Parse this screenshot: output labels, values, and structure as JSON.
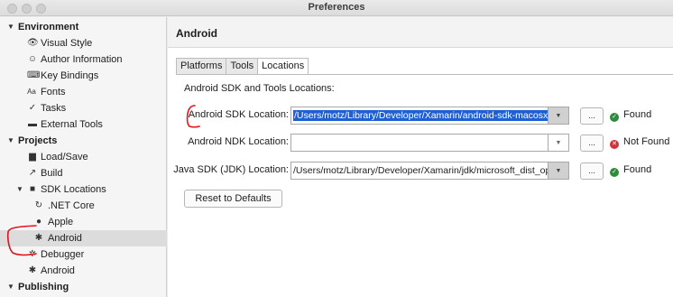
{
  "window": {
    "title": "Preferences"
  },
  "sidebar": {
    "items": [
      {
        "label": "Environment",
        "kind": "category",
        "icon": "disclosure-open"
      },
      {
        "label": "Visual Style",
        "kind": "item",
        "icon": "eye-icon"
      },
      {
        "label": "Author Information",
        "kind": "item",
        "icon": "smiley-icon"
      },
      {
        "label": "Key Bindings",
        "kind": "item",
        "icon": "keyboard-icon"
      },
      {
        "label": "Fonts",
        "kind": "item",
        "icon": "fonts-icon",
        "icon_glyph": "Aa"
      },
      {
        "label": "Tasks",
        "kind": "item",
        "icon": "checkmark-icon"
      },
      {
        "label": "External Tools",
        "kind": "item",
        "icon": "toolbox-icon"
      },
      {
        "label": "Projects",
        "kind": "category",
        "icon": "disclosure-open"
      },
      {
        "label": "Load/Save",
        "kind": "item",
        "icon": "drive-icon"
      },
      {
        "label": "Build",
        "kind": "item",
        "icon": "hammer-icon"
      },
      {
        "label": "SDK Locations",
        "kind": "folder",
        "icon": "folder-icon"
      },
      {
        "label": ".NET Core",
        "kind": "subitem",
        "icon": "dotnet-icon"
      },
      {
        "label": "Apple",
        "kind": "subitem",
        "icon": "apple-icon"
      },
      {
        "label": "Android",
        "kind": "subitem",
        "icon": "android-icon",
        "selected": true
      },
      {
        "label": "Debugger",
        "kind": "item",
        "icon": "bug-icon"
      },
      {
        "label": "Android",
        "kind": "item",
        "icon": "android-icon"
      },
      {
        "label": "Publishing",
        "kind": "category",
        "icon": "disclosure-open"
      }
    ]
  },
  "main": {
    "header": "Android",
    "tabs": [
      {
        "label": "Platforms",
        "active": false
      },
      {
        "label": "Tools",
        "active": false
      },
      {
        "label": "Locations",
        "active": true
      }
    ],
    "section_title": "Android SDK and Tools Locations:",
    "fields": [
      {
        "label": "Android SDK Location:",
        "value": "/Users/motz/Library/Developer/Xamarin/android-sdk-macosx",
        "selected": true,
        "status": "Found",
        "status_ok": true
      },
      {
        "label": "Android NDK Location:",
        "value": "",
        "selected": false,
        "status": "Not Found",
        "status_ok": false
      },
      {
        "label": "Java SDK (JDK) Location:",
        "value": "/Users/motz/Library/Developer/Xamarin/jdk/microsoft_dist_openjdk",
        "selected": false,
        "status": "Found",
        "status_ok": true
      }
    ],
    "browse_label": "...",
    "reset_label": "Reset to Defaults"
  },
  "colors": {
    "selection": "#1f5fd6",
    "found": "#2e8b3e",
    "not_found": "#d0323b",
    "annotation": "#e3111b"
  }
}
